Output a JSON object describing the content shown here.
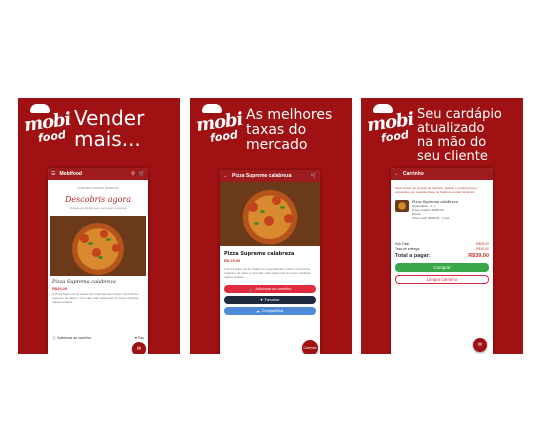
{
  "brand": {
    "logo_word1": "mobi",
    "logo_word2": "food"
  },
  "panels": [
    {
      "headline": [
        "Vender",
        "mais..."
      ]
    },
    {
      "headline": [
        "As melhores",
        "taxas do",
        "mercado"
      ]
    },
    {
      "headline": [
        "Seu cardápio",
        "atualizado",
        "na mão do",
        "seu cliente"
      ]
    }
  ],
  "screen1": {
    "title": "Mobifood",
    "topnote": "CONFIRA NOSSAS OFERTAS",
    "script_heading": "Descobris agora",
    "subnote": "Nossas as ofertas que você quer e precisa",
    "product_name": "Pizza Suprema calabreza",
    "price": "R$29,00",
    "description": "A Pizza Suprema foi criada com ingredientes nobres. Uma Pizza original e de sabor e uma das mais saborosas do nosso cardápio massa perfeita",
    "add_to_cart": "Adicionar ao carrinho",
    "favorite": "Fav"
  },
  "screen2": {
    "title": "Pizza Supreme calabreza",
    "price": "R$ 29,00",
    "description": "A Pizza Suprema foi criada com ingredientes nobres. Uma Pizza original e de sabor e uma das mais saborosas do nosso cardápio massa perfeita",
    "btn_add": "Adicionar ao carrinho",
    "btn_fav": "Favoritar",
    "btn_share": "Compartilhar",
    "fab": "Carrinho"
  },
  "screen3": {
    "title": "Carrinho",
    "note": "Para revisar um produto do carrinho, deslize o produto para a esquerda e em seguida clique no botão de excluir da lixeira.",
    "item_name": "Pizza Suprema calabreza",
    "item_qty_label": "Quantidade",
    "item_qty": "1",
    "item_unit": "Preço unitário: R$39,00",
    "item_extra": "Extras:",
    "item_total": "Preço total: R$39,00 · 1 item",
    "subtotal_label": "Sub Total",
    "subtotal_value": "R$29,00",
    "delivery_label": "Taxa de entrega",
    "delivery_value": "R$10,00",
    "total_label": "Total a pagar:",
    "total_value": "R$39,00",
    "btn_buy": "Comprar",
    "btn_clear": "Limpar carrinho"
  },
  "colors": {
    "brand_red": "#a01113",
    "button_red": "#e02a3d",
    "green": "#39a84a",
    "navy": "#1f2a3e",
    "blue": "#4f8ad9"
  },
  "icons": [
    "menu-icon",
    "search-icon",
    "cart-icon",
    "back-icon",
    "heart-icon",
    "share-icon",
    "chat-icon"
  ]
}
